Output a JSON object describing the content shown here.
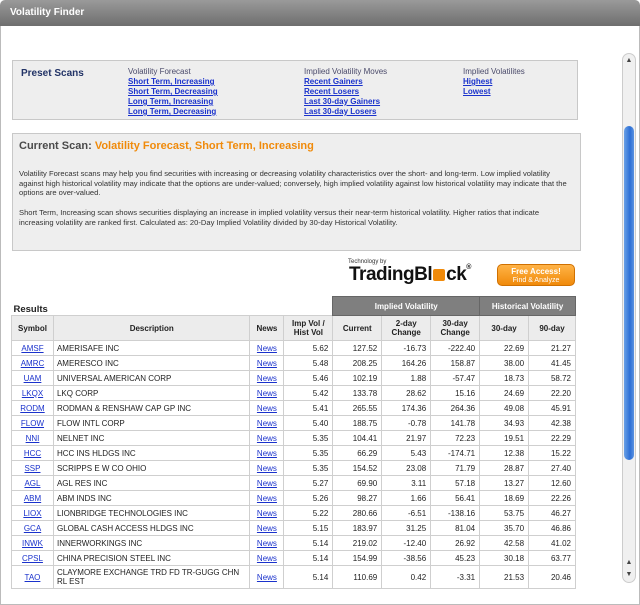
{
  "window": {
    "title": "Volatility Finder"
  },
  "preset": {
    "title": "Preset Scans",
    "columns": [
      {
        "heading": "Volatility Forecast",
        "links": [
          "Short Term, Increasing",
          "Short Term, Decreasing ",
          "Long Term, Increasing ",
          "Long Term, Decreasing "
        ]
      },
      {
        "heading": "Implied Volatility Moves",
        "links": [
          "Recent Gainers ",
          "Recent Losers",
          "Last 30-day Gainers",
          "Last 30-day Losers"
        ]
      },
      {
        "heading": "Implied Volatilites",
        "links": [
          "Highest ",
          "Lowest"
        ]
      }
    ]
  },
  "current_scan": {
    "label": "Current Scan:",
    "value": "Volatility Forecast, Short Term, Increasing",
    "p1": "Volatility Forecast scans may help you find securities with increasing or decreasing volatility characteristics over the short- and long-term. Low implied volatility against high historical volatility may indicate that the options are under-valued; conversely, high implied volatility against low historical volatility may indicate that the options are over-valued.",
    "p2": "Short Term, Increasing scan shows securities displaying an increase in implied volatility versus their near-term historical volatility. Higher ratios that indicate increasing volatility are ranked first. Calculated as: 20-Day Implied Volatility divided by 30-day Historical Volatility."
  },
  "sponsor": {
    "tech_by": "Technology by",
    "brand_a": "TradingBl",
    "brand_b": "ck",
    "free_main": "Free Access!",
    "free_sub": "Find & Analyze"
  },
  "results": {
    "title": "Results",
    "group_iv": "Implied Volatility",
    "group_hv": "Historical Volatility",
    "headers": {
      "symbol": "Symbol",
      "description": "Description",
      "news": "News",
      "ratio_a": "Imp Vol /",
      "ratio_b": "Hist Vol",
      "current": "Current",
      "d2a": "2-day",
      "d2b": "Change",
      "d30a": "30-day",
      "d30b": "Change",
      "h30": "30-day",
      "h90": "90-day"
    },
    "rows": [
      {
        "sym": "AMSF",
        "desc": "AMERISAFE INC",
        "news": "News",
        "ratio": "5.62",
        "cur": "127.52",
        "c2": "-16.73",
        "c30": "-222.40",
        "h30": "22.69",
        "h90": "21.27"
      },
      {
        "sym": "AMRC",
        "desc": "AMERESCO INC",
        "news": "News",
        "ratio": "5.48",
        "cur": "208.25",
        "c2": "164.26",
        "c30": "158.87",
        "h30": "38.00",
        "h90": "41.45"
      },
      {
        "sym": "UAM",
        "desc": "UNIVERSAL AMERICAN CORP",
        "news": "News",
        "ratio": "5.46",
        "cur": "102.19",
        "c2": "1.88",
        "c30": "-57.47",
        "h30": "18.73",
        "h90": "58.72"
      },
      {
        "sym": "LKQX",
        "desc": "LKQ CORP",
        "news": "News",
        "ratio": "5.42",
        "cur": "133.78",
        "c2": "28.62",
        "c30": "15.16",
        "h30": "24.69",
        "h90": "22.20"
      },
      {
        "sym": "RODM",
        "desc": "RODMAN & RENSHAW CAP GP INC",
        "news": "News",
        "ratio": "5.41",
        "cur": "265.55",
        "c2": "174.36",
        "c30": "264.36",
        "h30": "49.08",
        "h90": "45.91"
      },
      {
        "sym": "FLOW",
        "desc": "FLOW INTL CORP",
        "news": "News",
        "ratio": "5.40",
        "cur": "188.75",
        "c2": "-0.78",
        "c30": "141.78",
        "h30": "34.93",
        "h90": "42.38"
      },
      {
        "sym": "NNI",
        "desc": "NELNET INC",
        "news": "News",
        "ratio": "5.35",
        "cur": "104.41",
        "c2": "21.97",
        "c30": "72.23",
        "h30": "19.51",
        "h90": "22.29"
      },
      {
        "sym": "HCC",
        "desc": "HCC INS HLDGS INC",
        "news": "News",
        "ratio": "5.35",
        "cur": "66.29",
        "c2": "5.43",
        "c30": "-174.71",
        "h30": "12.38",
        "h90": "15.22"
      },
      {
        "sym": "SSP",
        "desc": "SCRIPPS E W CO OHIO",
        "news": "News",
        "ratio": "5.35",
        "cur": "154.52",
        "c2": "23.08",
        "c30": "71.79",
        "h30": "28.87",
        "h90": "27.40"
      },
      {
        "sym": "AGL",
        "desc": "AGL RES INC",
        "news": "News",
        "ratio": "5.27",
        "cur": "69.90",
        "c2": "3.11",
        "c30": "57.18",
        "h30": "13.27",
        "h90": "12.60"
      },
      {
        "sym": "ABM",
        "desc": "ABM INDS INC",
        "news": "News",
        "ratio": "5.26",
        "cur": "98.27",
        "c2": "1.66",
        "c30": "56.41",
        "h30": "18.69",
        "h90": "22.26"
      },
      {
        "sym": "LIOX",
        "desc": "LIONBRIDGE TECHNOLOGIES INC",
        "news": "News",
        "ratio": "5.22",
        "cur": "280.66",
        "c2": "-6.51",
        "c30": "-138.16",
        "h30": "53.75",
        "h90": "46.27"
      },
      {
        "sym": "GCA",
        "desc": "GLOBAL CASH ACCESS HLDGS INC",
        "news": "News",
        "ratio": "5.15",
        "cur": "183.97",
        "c2": "31.25",
        "c30": "81.04",
        "h30": "35.70",
        "h90": "46.86"
      },
      {
        "sym": "INWK",
        "desc": "INNERWORKINGS INC",
        "news": "News",
        "ratio": "5.14",
        "cur": "219.02",
        "c2": "-12.40",
        "c30": "26.92",
        "h30": "42.58",
        "h90": "41.02"
      },
      {
        "sym": "CPSL",
        "desc": "CHINA PRECISION STEEL INC",
        "news": "News",
        "ratio": "5.14",
        "cur": "154.99",
        "c2": "-38.56",
        "c30": "45.23",
        "h30": "30.18",
        "h90": "63.77"
      },
      {
        "sym": "TAO",
        "desc": "CLAYMORE EXCHANGE TRD FD TR-GUGG CHN RL EST",
        "news": "News",
        "ratio": "5.14",
        "cur": "110.69",
        "c2": "0.42",
        "c30": "-3.31",
        "h30": "21.53",
        "h90": "20.46"
      }
    ]
  }
}
